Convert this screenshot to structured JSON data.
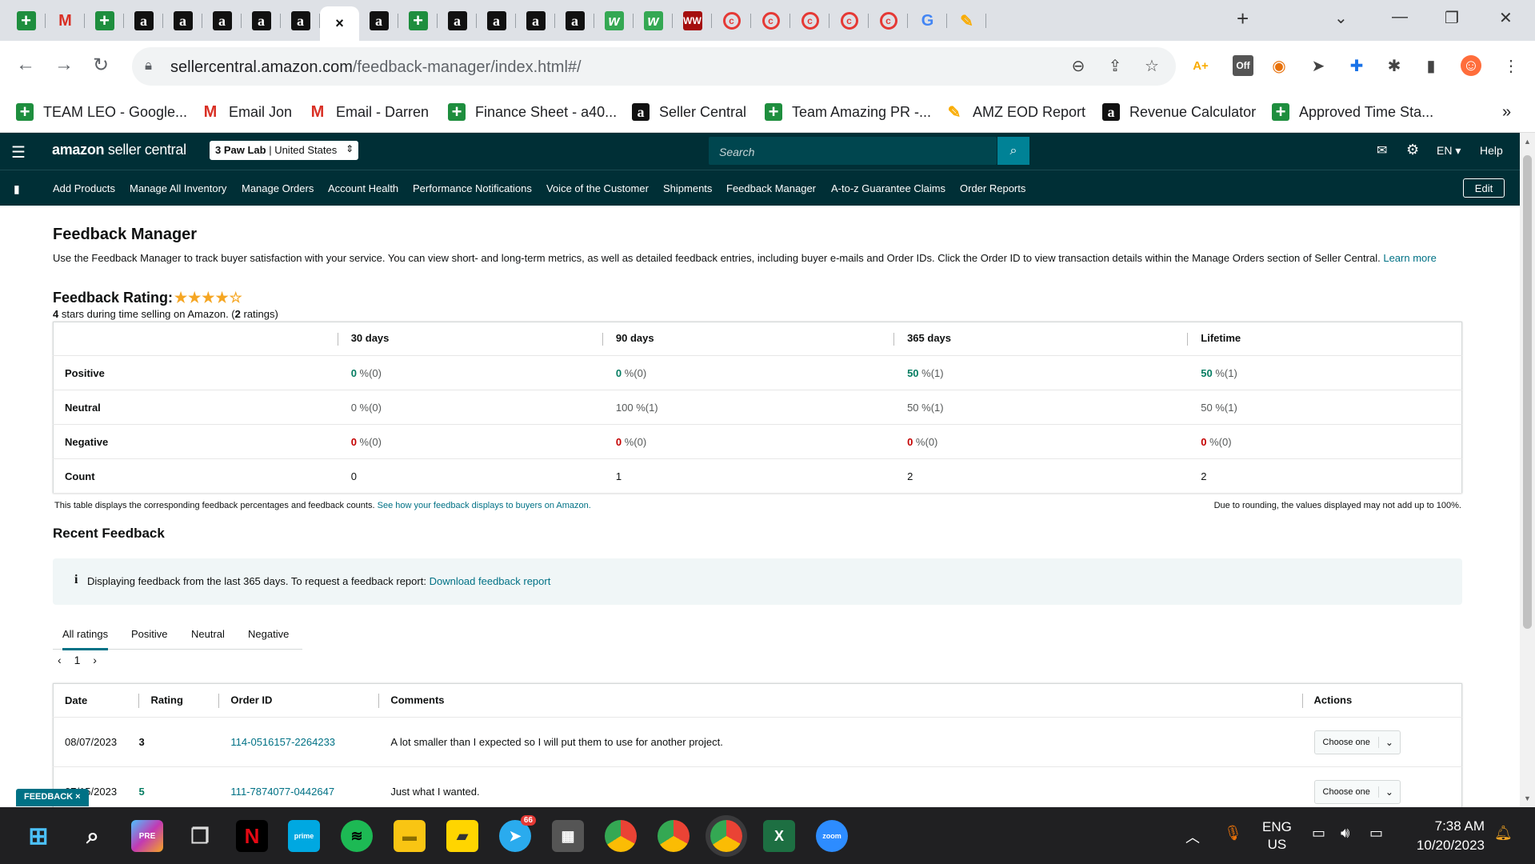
{
  "browser": {
    "tabs": [
      {
        "icon": "sheets-icon",
        "glyph": "+"
      },
      {
        "icon": "gmail-icon",
        "glyph": "M"
      },
      {
        "icon": "sheets-icon",
        "glyph": "+"
      },
      {
        "icon": "amazon-icon",
        "glyph": "a"
      },
      {
        "icon": "amazon-icon",
        "glyph": "a"
      },
      {
        "icon": "amazon-icon",
        "glyph": "a"
      },
      {
        "icon": "amazon-icon",
        "glyph": "a"
      },
      {
        "icon": "amazon-icon",
        "glyph": "a"
      },
      {
        "icon": "close-icon",
        "glyph": "×",
        "active": true
      },
      {
        "icon": "amazon-icon",
        "glyph": "a"
      },
      {
        "icon": "sheets-icon",
        "glyph": "+"
      },
      {
        "icon": "amazon-icon",
        "glyph": "a"
      },
      {
        "icon": "amazon-icon",
        "glyph": "a"
      },
      {
        "icon": "amazon-icon",
        "glyph": "a"
      },
      {
        "icon": "amazon-icon",
        "glyph": "a"
      },
      {
        "icon": "w-icon",
        "glyph": "w"
      },
      {
        "icon": "w-icon",
        "glyph": "w"
      },
      {
        "icon": "ww-icon",
        "glyph": "WW"
      },
      {
        "icon": "c-icon",
        "glyph": "c"
      },
      {
        "icon": "c-icon",
        "glyph": "c"
      },
      {
        "icon": "c-icon",
        "glyph": "c"
      },
      {
        "icon": "c-icon",
        "glyph": "c"
      },
      {
        "icon": "c-icon",
        "glyph": "c"
      },
      {
        "icon": "google-icon",
        "glyph": "G"
      },
      {
        "icon": "rocket-icon",
        "glyph": "✎"
      }
    ],
    "new_tab": "+",
    "url_host": "sellercentral.amazon.com",
    "url_path": "/feedback-manager/index.html#/",
    "bookmarks": [
      {
        "label": "TEAM LEO - Google...",
        "icon": "sheets-icon",
        "glyph": "+"
      },
      {
        "label": "Email Jon",
        "icon": "gmail-icon",
        "glyph": "M"
      },
      {
        "label": "Email - Darren",
        "icon": "gmail-icon",
        "glyph": "M"
      },
      {
        "label": "Finance Sheet - a40...",
        "icon": "sheets-icon",
        "glyph": "+"
      },
      {
        "label": "Seller Central",
        "icon": "amazon-icon",
        "glyph": "a"
      },
      {
        "label": "Team Amazing PR -...",
        "icon": "sheets-icon",
        "glyph": "+"
      },
      {
        "label": "AMZ EOD Report",
        "icon": "clickup-icon",
        "glyph": "✎"
      },
      {
        "label": "Revenue Calculator",
        "icon": "amazon-icon",
        "glyph": "a"
      },
      {
        "label": "Approved Time Sta...",
        "icon": "sheets-icon",
        "glyph": "+"
      }
    ],
    "more_bookmarks": "»"
  },
  "header": {
    "logo_brand": "amazon",
    "logo_product": "seller central",
    "store": "3 Paw Lab",
    "marketplace": "United States",
    "search_placeholder": "Search",
    "language": "EN",
    "help": "Help"
  },
  "nav": {
    "links": [
      "Add Products",
      "Manage All Inventory",
      "Manage Orders",
      "Account Health",
      "Performance Notifications",
      "Voice of the Customer",
      "Shipments",
      "Feedback Manager",
      "A-to-z Guarantee Claims",
      "Order Reports"
    ],
    "edit": "Edit"
  },
  "page": {
    "title": "Feedback Manager",
    "intro": "Use the Feedback Manager to track buyer satisfaction with your service. You can view short- and long-term metrics, as well as detailed feedback entries, including buyer e-mails and Order IDs. Click the Order ID to view transaction details within the Manage Orders section of Seller Central.",
    "learn_more": "Learn more",
    "rating_title": "Feedback Rating:",
    "rating_stars": 4,
    "rating_stars_max": 5,
    "rating_count_stars": "4",
    "rating_sub_text": "stars during time selling on Amazon. (",
    "rating_count": "2",
    "rating_sub_end": "ratings)"
  },
  "metrics": {
    "columns": [
      "30 days",
      "90 days",
      "365 days",
      "Lifetime"
    ],
    "rows": [
      {
        "label": "Positive",
        "tone": "g",
        "cells": [
          [
            "0",
            " %(0)"
          ],
          [
            "0",
            " %(0)"
          ],
          [
            "50",
            " %(1)"
          ],
          [
            "50",
            " %(1)"
          ]
        ]
      },
      {
        "label": "Neutral",
        "tone": "n",
        "cells": [
          [
            "0",
            " %(0)"
          ],
          [
            "100",
            " %(1)"
          ],
          [
            "50",
            " %(1)"
          ],
          [
            "50",
            " %(1)"
          ]
        ]
      },
      {
        "label": "Negative",
        "tone": "r",
        "cells": [
          [
            "0",
            " %(0)"
          ],
          [
            "0",
            " %(0)"
          ],
          [
            "0",
            " %(0)"
          ],
          [
            "0",
            " %(0)"
          ]
        ]
      },
      {
        "label": "Count",
        "tone": "c",
        "cells": [
          [
            "0",
            ""
          ],
          [
            "1",
            ""
          ],
          [
            "2",
            ""
          ],
          [
            "2",
            ""
          ]
        ]
      }
    ],
    "note_left": "This table displays the corresponding feedback percentages and feedback counts.",
    "note_left_link": "See how your feedback displays to buyers on Amazon.",
    "note_right": "Due to rounding, the values displayed may not add up to 100%."
  },
  "recent": {
    "title": "Recent Feedback",
    "info_icon": "i",
    "info_text": "Displaying feedback from the last 365 days. To request a feedback report:",
    "info_link": "Download feedback report",
    "tabs": [
      "All ratings",
      "Positive",
      "Neutral",
      "Negative"
    ],
    "page": "1",
    "columns": [
      "Date",
      "Rating",
      "Order ID",
      "Comments",
      "Actions"
    ],
    "rows": [
      {
        "date": "08/07/2023",
        "rating": "3",
        "order": "114-0516157-2264233",
        "comment": "A lot smaller than I expected so I will put them to use for another project.",
        "action": "Choose one"
      },
      {
        "date": "07/15/2023",
        "rating": "5",
        "order": "111-7874077-0442647",
        "comment": "Just what I wanted.",
        "action": "Choose one"
      }
    ],
    "feedback_tag": "FEEDBACK ×"
  },
  "taskbar": {
    "lang_top": "ENG",
    "lang_bottom": "US",
    "time": "7:38 AM",
    "date": "10/20/2023",
    "telegram_badge": "66"
  },
  "colors": {
    "header": "#002f36",
    "link": "#007185",
    "positive": "#067d62",
    "negative": "#c40000",
    "star": "#f5a623"
  }
}
